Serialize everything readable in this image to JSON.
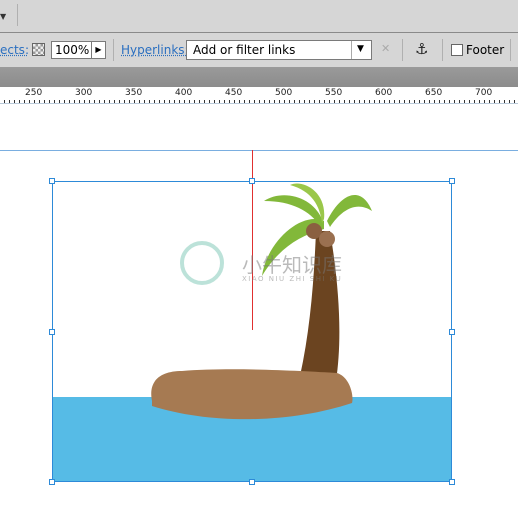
{
  "toolbar": {
    "effects_label": "ects:",
    "opacity_value": "100%",
    "hyperlinks_label": "Hyperlinks:",
    "hyperlinks_placeholder": "Add or filter links",
    "footer_label": "Footer",
    "footer_checked": false
  },
  "ruler": {
    "labels": [
      "250",
      "300",
      "350",
      "400",
      "450",
      "500",
      "550",
      "600",
      "650",
      "700"
    ]
  },
  "watermark": {
    "text": "小牛知识库",
    "subtext": "XIAO NIU ZHI SHI KU"
  },
  "colors": {
    "sea": "#56bbe6",
    "island": "#a67a52",
    "trunk": "#6b4420",
    "leaves": "#82b83a",
    "selection": "#2d8ad8",
    "guide": "#e03030"
  }
}
